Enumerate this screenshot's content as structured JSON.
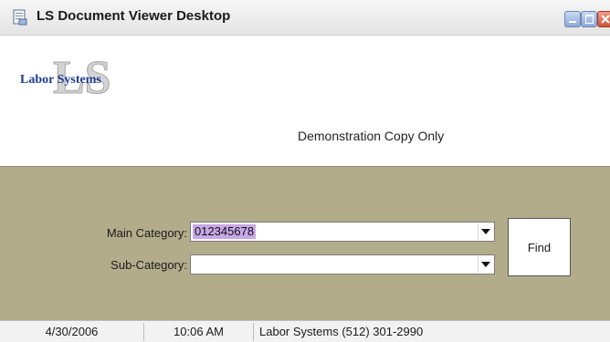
{
  "window": {
    "title": "LS Document Viewer Desktop",
    "icons": [
      "document-viewer-icon",
      "minimize-icon",
      "maximize-icon",
      "close-icon"
    ]
  },
  "header": {
    "logo_text": "Labor Systems",
    "notice": "Demonstration Copy Only"
  },
  "form": {
    "main_category_label": "Main Category:",
    "main_category_value": "012345678",
    "sub_category_label": "Sub-Category:",
    "sub_category_value": "",
    "find_label": "Find"
  },
  "status": {
    "date": "4/30/2006",
    "time": "10:06 AM",
    "company": "Labor Systems  (512) 301-2990"
  },
  "colors": {
    "panel": "#b3ac8b",
    "title_text": "#1a1a1a",
    "logo_blue": "#1f3a93",
    "selection": "#c8a8e8"
  }
}
